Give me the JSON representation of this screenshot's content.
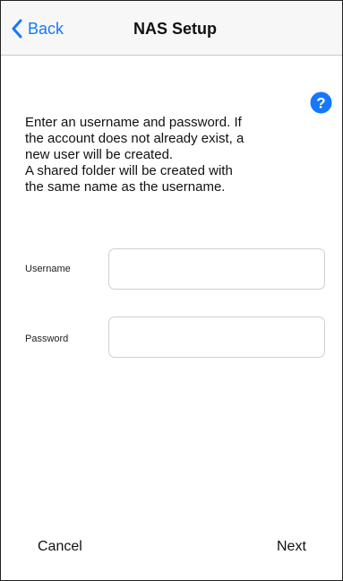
{
  "navbar": {
    "back_label": "Back",
    "title": "NAS Setup"
  },
  "help": {
    "icon": "question-circle-icon",
    "glyph": "?",
    "color": "#1479fb"
  },
  "instructions": {
    "line1": "Enter an username and password. If",
    "line2": "the account does not already exist, a",
    "line3": "new user will be created.",
    "line4": "A shared folder will be created with",
    "line5": "the same name as the username."
  },
  "form": {
    "username_label": "Username",
    "username_value": "",
    "password_label": "Password",
    "password_value": ""
  },
  "footer": {
    "cancel_label": "Cancel",
    "next_label": "Next"
  },
  "colors": {
    "accent": "#1479fb",
    "navbar_bg": "#f7f7f7"
  }
}
